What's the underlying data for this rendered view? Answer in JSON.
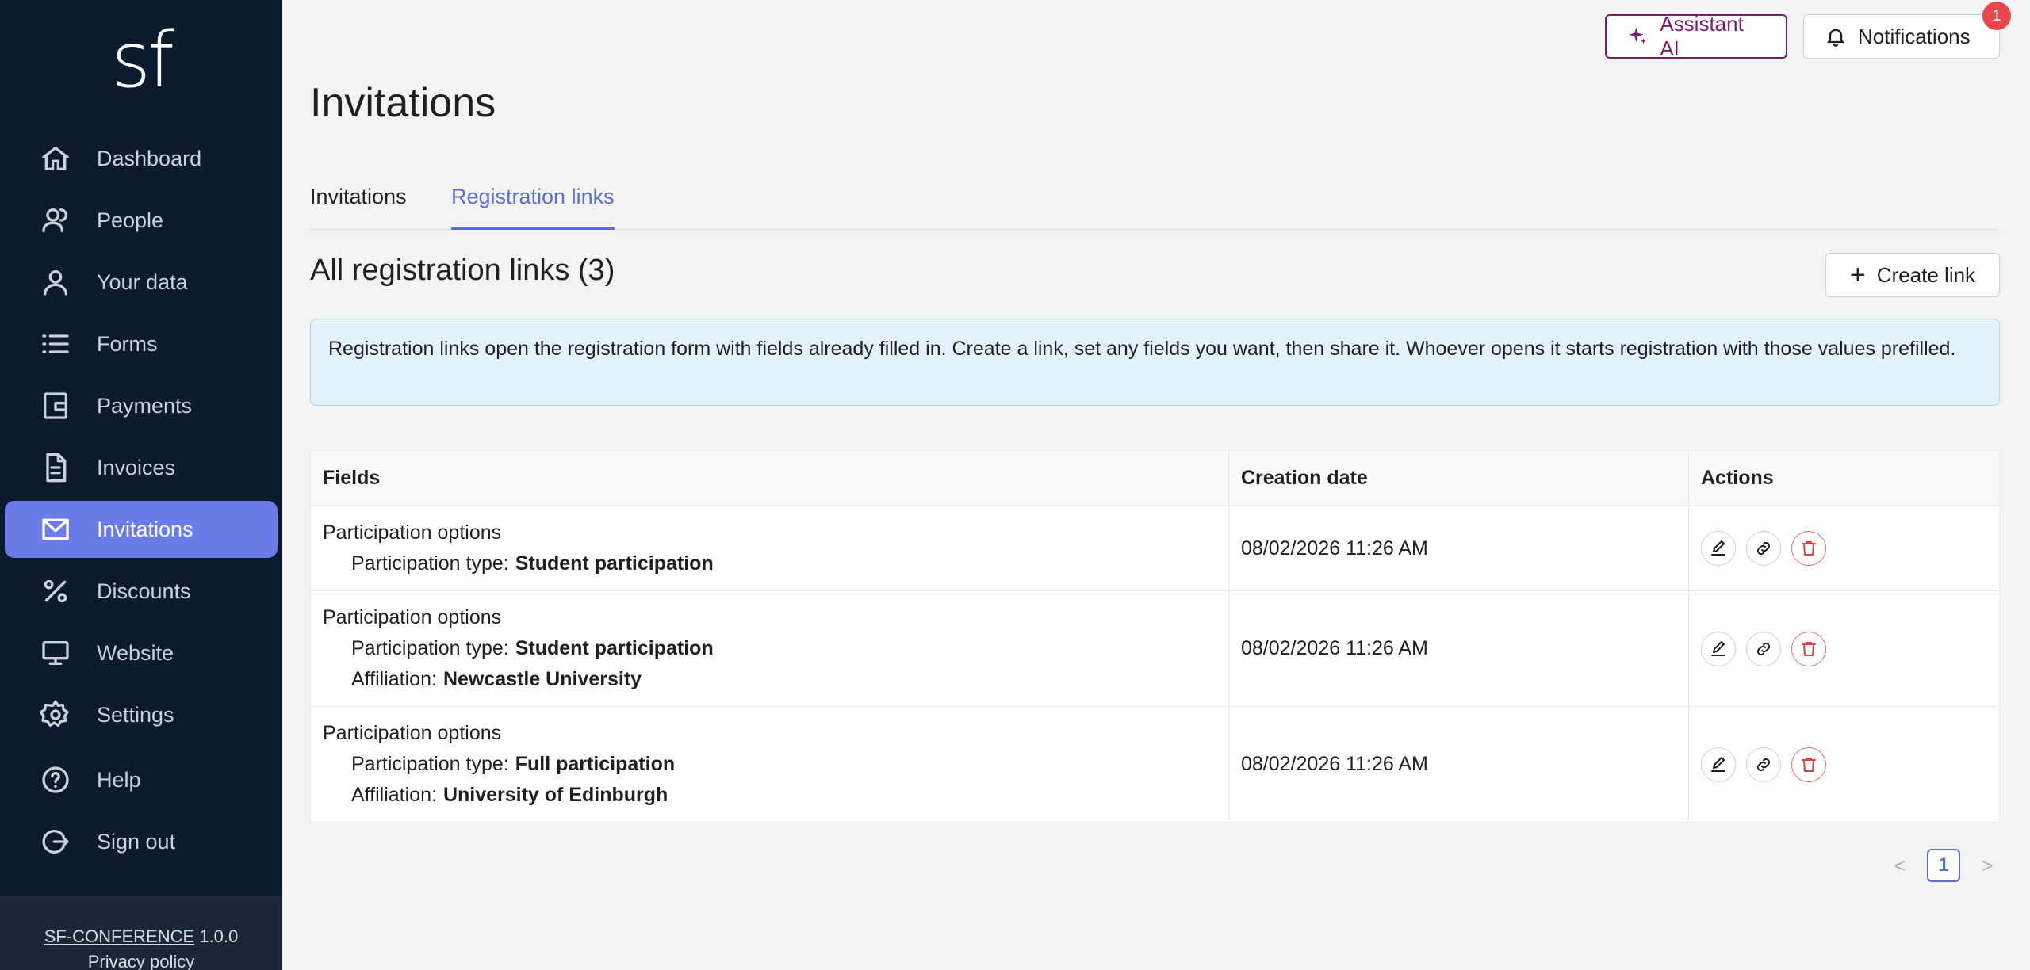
{
  "app": {
    "logo": "sf",
    "footer": {
      "product": "SF-CONFERENCE",
      "version": "1.0.0",
      "privacy": "Privacy policy"
    }
  },
  "sidebar": {
    "items": [
      {
        "label": "Dashboard",
        "icon": "home-icon"
      },
      {
        "label": "People",
        "icon": "people-icon"
      },
      {
        "label": "Your data",
        "icon": "user-icon"
      },
      {
        "label": "Forms",
        "icon": "list-icon"
      },
      {
        "label": "Payments",
        "icon": "wallet-icon"
      },
      {
        "label": "Invoices",
        "icon": "document-icon"
      },
      {
        "label": "Invitations",
        "icon": "mail-icon",
        "active": true
      },
      {
        "label": "Discounts",
        "icon": "percent-icon"
      },
      {
        "label": "Website",
        "icon": "monitor-icon"
      },
      {
        "label": "Settings",
        "icon": "gear-icon"
      },
      {
        "label": "Help",
        "icon": "help-icon"
      },
      {
        "label": "Sign out",
        "icon": "sign-out-icon"
      }
    ]
  },
  "header": {
    "assistant_label": "Assistant AI",
    "notifications_label": "Notifications",
    "notifications_count": "1"
  },
  "page": {
    "title": "Invitations",
    "tabs": [
      {
        "label": "Invitations",
        "active": false
      },
      {
        "label": "Registration links",
        "active": true
      }
    ],
    "section_title": "All registration links (3)",
    "create_button": "Create link",
    "info": "Registration links open the registration form with fields already filled in. Create a link, set any fields you want, then share it. Whoever opens it starts registration with those values prefilled."
  },
  "table": {
    "columns": [
      "Fields",
      "Creation date",
      "Actions"
    ],
    "rows": [
      {
        "group": "Participation options",
        "fields": [
          {
            "label": "Participation type:",
            "value": "Student participation"
          }
        ],
        "date": "08/02/2026 11:26 AM"
      },
      {
        "group": "Participation options",
        "fields": [
          {
            "label": "Participation type:",
            "value": "Student participation"
          },
          {
            "label": "Affiliation:",
            "value": "Newcastle University"
          }
        ],
        "date": "08/02/2026 11:26 AM"
      },
      {
        "group": "Participation options",
        "fields": [
          {
            "label": "Participation type:",
            "value": "Full participation"
          },
          {
            "label": "Affiliation:",
            "value": "University of Edinburgh"
          }
        ],
        "date": "08/02/2026 11:26 AM"
      }
    ]
  },
  "pagination": {
    "current": "1",
    "prev": "<",
    "next": ">"
  },
  "colors": {
    "sidebar_bg": "#0c1a2e",
    "accent": "#6b7ce8",
    "link_tab": "#5b6fd6",
    "ai": "#7a1c6e",
    "danger": "#d64545",
    "badge": "#e5484d"
  }
}
